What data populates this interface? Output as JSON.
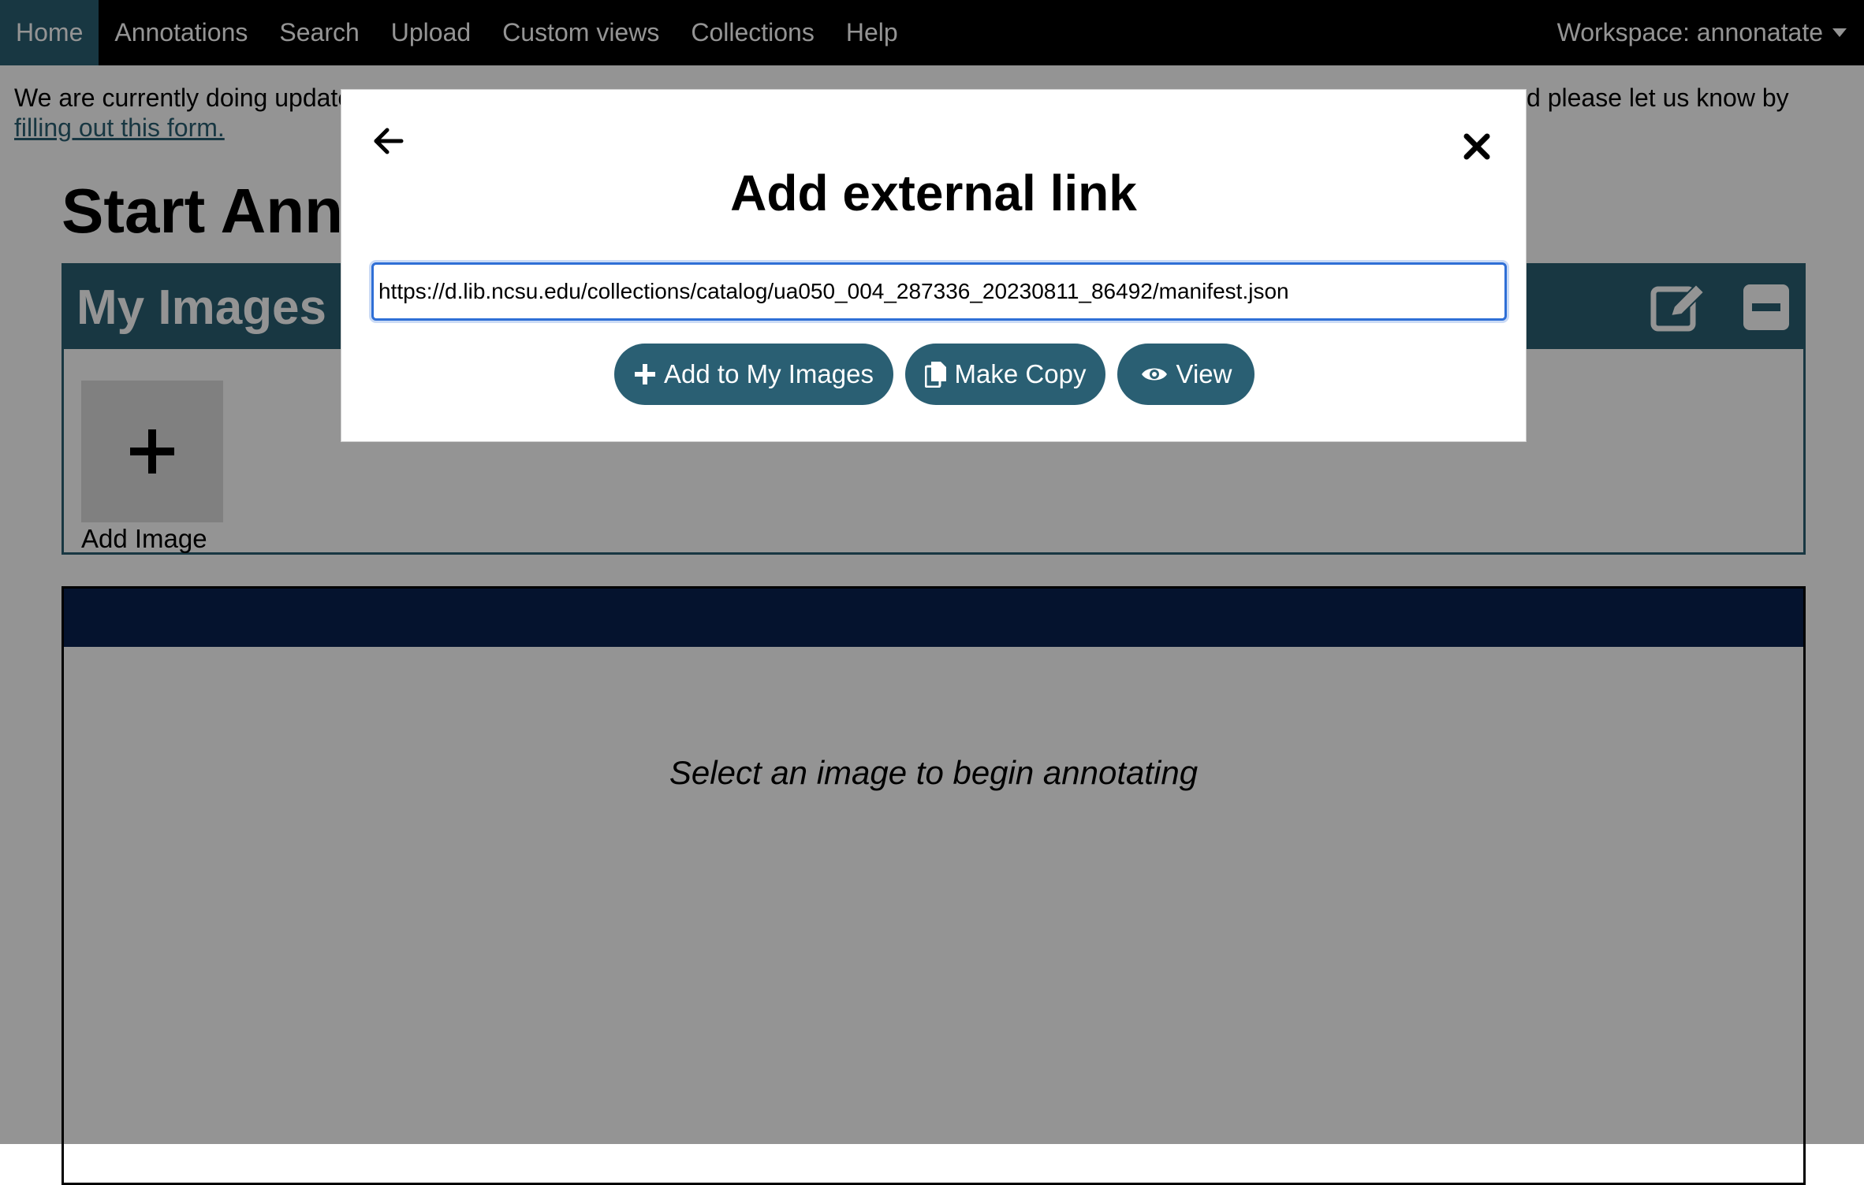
{
  "nav": {
    "items": [
      {
        "label": "Home",
        "active": true
      },
      {
        "label": "Annotations"
      },
      {
        "label": "Search"
      },
      {
        "label": "Upload"
      },
      {
        "label": "Custom views"
      },
      {
        "label": "Collections"
      },
      {
        "label": "Help"
      }
    ],
    "workspace": "Workspace: annonatate"
  },
  "announcement": {
    "text_start": "We are currently doing update",
    "text_end": "d please let us know by",
    "link": "filling out this form."
  },
  "page": {
    "title": "Start Anne"
  },
  "my_images": {
    "title": "My Images",
    "add_image_label": "Add Image"
  },
  "annotator": {
    "placeholder": "Select an image to begin annotating"
  },
  "modal": {
    "title": "Add external link",
    "url_value": "https://d.lib.ncsu.edu/collections/catalog/ua050_004_287336_20230811_86492/manifest.json",
    "buttons": {
      "add": "Add to My Images",
      "copy": "Make Copy",
      "view": "View"
    }
  },
  "colors": {
    "nav_bg": "#000000",
    "accent": "#2a5f73",
    "annotator_bar": "#0a2150",
    "input_focus": "#2f6fd6"
  },
  "icons": [
    "back-arrow-icon",
    "close-icon",
    "plus-icon",
    "copy-icon",
    "eye-icon",
    "edit-icon",
    "collapse-icon",
    "caret-down-icon"
  ]
}
